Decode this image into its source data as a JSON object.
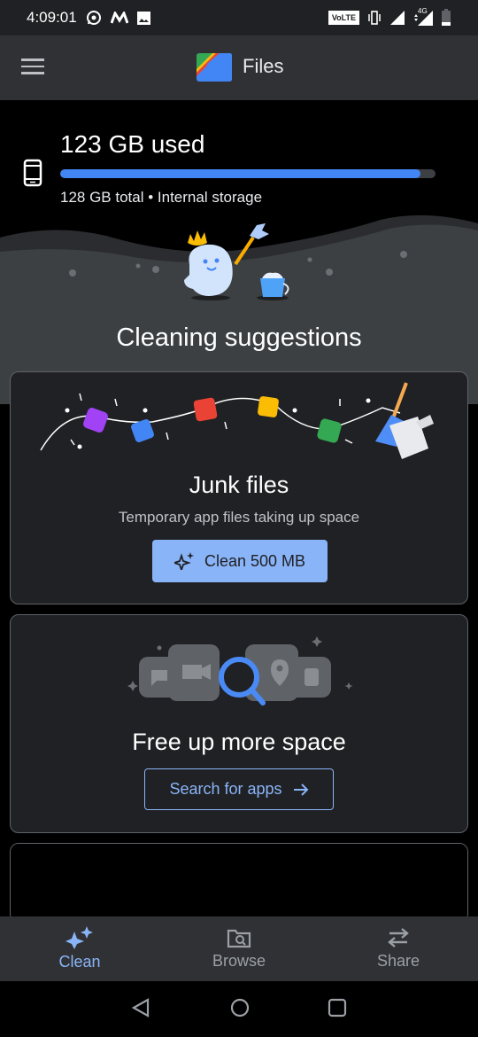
{
  "status_bar": {
    "time": "4:09:01",
    "left_icons": [
      "whatsapp-icon",
      "m-app-icon",
      "gallery-icon"
    ],
    "volte_label": "VoLTE",
    "network_label": "4G",
    "right_icons": [
      "vibrate-icon",
      "signal-icon",
      "data-signal-icon",
      "battery-icon"
    ]
  },
  "app_bar": {
    "title": "Files",
    "menu_icon": "hamburger-menu-icon",
    "logo_icon": "files-logo-icon"
  },
  "storage": {
    "used_label": "123 GB used",
    "used_gb": 123,
    "total_gb": 128,
    "used_fraction": 0.961,
    "total_label": "128 GB total • Internal storage",
    "colors": {
      "fill": "#4285f4",
      "track": "#3c4043"
    }
  },
  "section": {
    "heading": "Cleaning suggestions"
  },
  "cards": {
    "junk": {
      "title": "Junk files",
      "subtitle": "Temporary app files taking up space",
      "button_label": "Clean 500 MB",
      "button_icon": "sparkle-icon"
    },
    "free_space": {
      "title": "Free up more space",
      "button_label": "Search for apps",
      "button_icon": "arrow-right-icon"
    }
  },
  "bottom_nav": {
    "items": [
      {
        "label": "Clean",
        "icon": "sparkle-icon",
        "active": true
      },
      {
        "label": "Browse",
        "icon": "folder-search-icon",
        "active": false
      },
      {
        "label": "Share",
        "icon": "swap-arrows-icon",
        "active": false
      }
    ]
  },
  "system_nav": {
    "buttons": [
      "back-icon",
      "home-icon",
      "recents-icon"
    ]
  },
  "colors": {
    "accent": "#8ab4f8",
    "app_bar": "#303134",
    "card": "#202124",
    "background": "#000000"
  }
}
